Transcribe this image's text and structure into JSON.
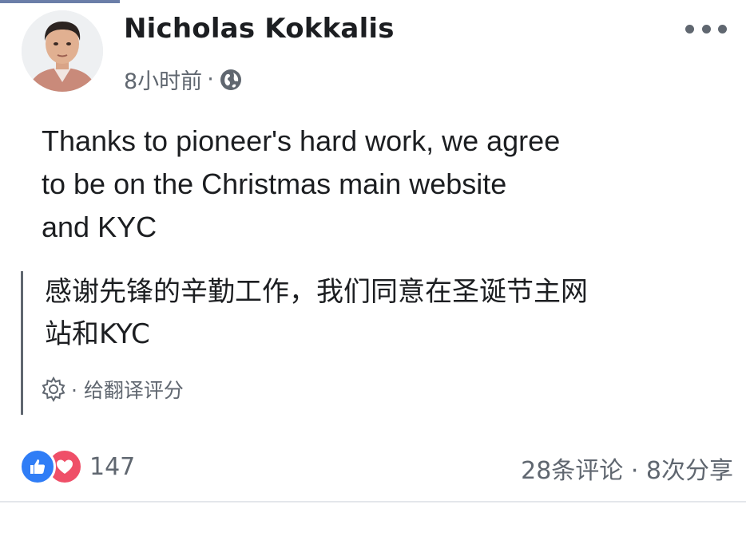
{
  "post": {
    "author": "Nicholas Kokkalis",
    "time": "8小时前",
    "separator": "·",
    "privacy_icon": "globe-icon",
    "more_icon": "more-options-icon",
    "text_lines": [
      "Thanks to pioneer's hard work, we agree",
      "to be on the Christmas main website",
      "and KYC"
    ]
  },
  "translation": {
    "text_lines": [
      "感谢先锋的辛勤工作，我们同意在圣诞节主网",
      "站和KYC"
    ],
    "rate_icon": "gear-icon",
    "rate_label": "· 给翻译评分"
  },
  "footer": {
    "reaction_icons": [
      "like-icon",
      "love-icon"
    ],
    "reaction_count": "147",
    "engagement": "28条评论 · 8次分享"
  },
  "colors": {
    "text": "#1c1e21",
    "secondary": "#606770",
    "like": "#2f7df6",
    "love": "#ef4f68"
  }
}
